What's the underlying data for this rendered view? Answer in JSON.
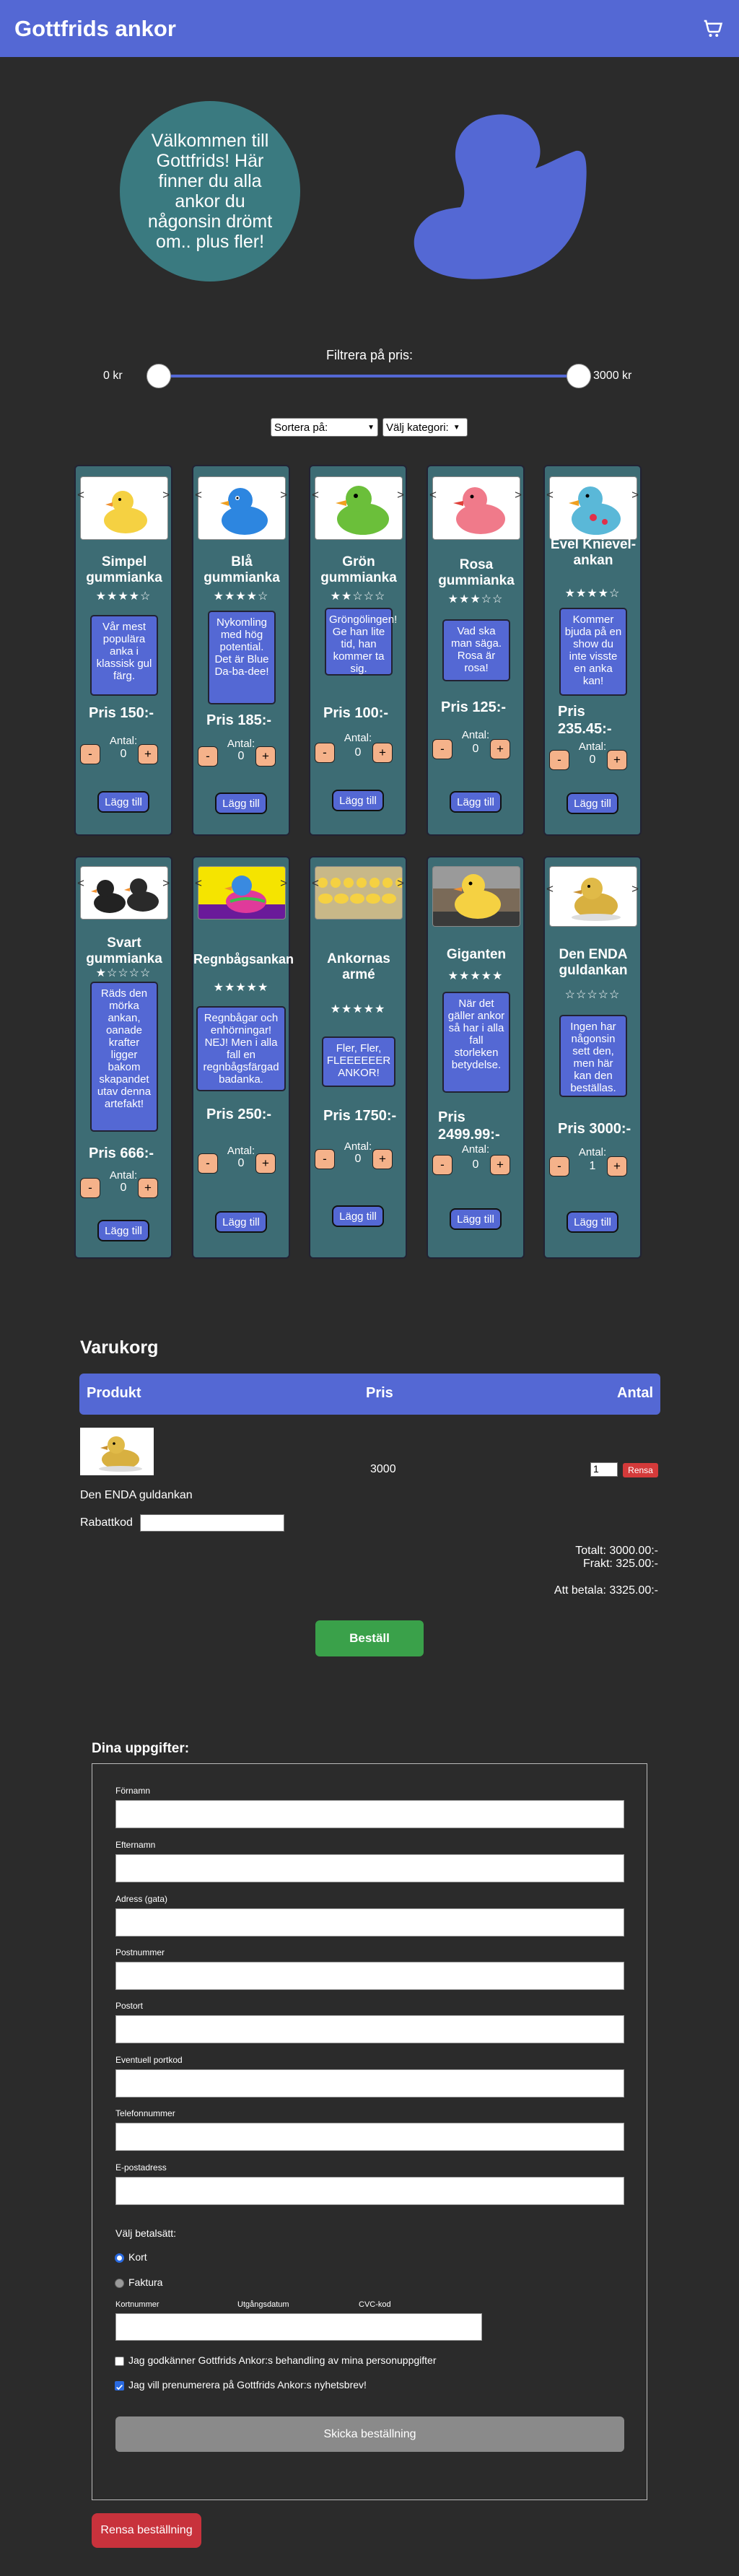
{
  "header": {
    "title": "Gottfrids ankor",
    "cart_icon": "cart-icon"
  },
  "hero": {
    "welcome": "Välkommen till Gottfrids! Här finner du alla ankor du någonsin drömt om.. plus fler!"
  },
  "filter": {
    "label": "Filtrera på pris:",
    "min_label": "0 kr",
    "max_label": "3000 kr",
    "min_value": 0,
    "max_value": 3000
  },
  "sort": {
    "sort_label": "Sortera på:",
    "category_label": "Välj kategori:"
  },
  "products": [
    {
      "name": "Simpel gummianka",
      "stars": "★★★★☆",
      "desc": "Vår mest populära anka i klassisk gul färg.",
      "price": "Pris 150:-",
      "qty_label": "Antal:",
      "qty": "0",
      "add": "Lägg till",
      "arrow_left": "<",
      "arrow_right": ">"
    },
    {
      "name": "Blå gummianka",
      "stars": "★★★★☆",
      "desc": "Nykomling med hög potential. Det är Blue Da-ba-dee!",
      "price": "Pris 185:-",
      "qty_label": "Antal:",
      "qty": "0",
      "add": "Lägg till",
      "arrow_left": "<",
      "arrow_right": ">"
    },
    {
      "name": "Grön gummianka",
      "stars": "★★☆☆☆",
      "desc": "Gröngölingen! Ge han lite tid, han kommer ta sig.",
      "price": "Pris 100:-",
      "qty_label": "Antal:",
      "qty": "0",
      "add": "Lägg till",
      "arrow_left": "<",
      "arrow_right": ">"
    },
    {
      "name": "Rosa gummianka",
      "stars": "★★★☆☆",
      "desc": "Vad ska man säga. Rosa är rosa!",
      "price": "Pris 125:-",
      "qty_label": "Antal:",
      "qty": "0",
      "add": "Lägg till",
      "arrow_left": "<",
      "arrow_right": ">"
    },
    {
      "name": "Evel Knievel-ankan",
      "stars": "★★★★☆",
      "desc": "Kommer bjuda på en show du inte visste en anka kan!",
      "price": "Pris 235.45:-",
      "qty_label": "Antal:",
      "qty": "0",
      "add": "Lägg till",
      "arrow_left": "<",
      "arrow_right": ">"
    },
    {
      "name": "Svart gummianka",
      "stars": "★☆☆☆☆",
      "desc": "Räds den mörka ankan, oanade krafter ligger bakom skapandet utav denna artefakt!",
      "price": "Pris 666:-",
      "qty_label": "Antal:",
      "qty": "0",
      "add": "Lägg till",
      "arrow_left": "<",
      "arrow_right": ">"
    },
    {
      "name": "Regnbågsankan",
      "stars": "★★★★★",
      "desc": "Regnbågar och enhörningar! NEJ! Men i alla fall en regnbågsfärgad badanka.",
      "price": "Pris 250:-",
      "qty_label": "Antal:",
      "qty": "0",
      "add": "Lägg till",
      "arrow_left": "<",
      "arrow_right": ">"
    },
    {
      "name": "Ankornas armé",
      "stars": "★★★★★",
      "desc": "Fler, Fler, FLEEEEEER ANKOR!",
      "price": "Pris 1750:-",
      "qty_label": "Antal:",
      "qty": "0",
      "add": "Lägg till",
      "arrow_left": "<",
      "arrow_right": ">"
    },
    {
      "name": "Giganten",
      "stars": "★★★★★",
      "desc": "När det gäller ankor så har i alla fall storleken betydelse.",
      "price": "Pris 2499.99:-",
      "qty_label": "Antal:",
      "qty": "0",
      "add": "Lägg till",
      "arrow_left": "<",
      "arrow_right": ">"
    },
    {
      "name": "Den ENDA guldankan",
      "stars": "☆☆☆☆☆",
      "desc": "Ingen har någonsin sett den, men här kan den beställas.",
      "price": "Pris 3000:-",
      "qty_label": "Antal:",
      "qty": "1",
      "add": "Lägg till",
      "arrow_left": "<",
      "arrow_right": ">"
    }
  ],
  "cart": {
    "title": "Varukorg",
    "col_product": "Produkt",
    "col_price": "Pris",
    "col_qty": "Antal",
    "item_name": "Den ENDA guldankan",
    "item_price": "3000",
    "item_qty": "1",
    "remove": "Rensa",
    "discount_label": "Rabattkod",
    "total": "Totalt: 3000.00:-",
    "shipping": "Frakt: 325.00:-",
    "to_pay": "Att betala: 3325.00:-",
    "order": "Beställ"
  },
  "form": {
    "title": "Dina uppgifter:",
    "fields": [
      "Förnamn",
      "Efternamn",
      "Adress (gata)",
      "Postnummer",
      "Postort",
      "Eventuell portkod",
      "Telefonnummer",
      "E-postadress"
    ],
    "payment_label": "Välj betalsätt:",
    "payment_card": "Kort",
    "payment_invoice": "Faktura",
    "card_number": "Kortnummer",
    "expiry": "Utgångsdatum",
    "cvc": "CVC-kod",
    "gdpr": "Jag godkänner Gottfrids Ankor:s behandling av mina personuppgifter",
    "newsletter": "Jag vill prenumerera på Gottfrids Ankor:s nyhetsbrev!",
    "submit": "Skicka beställning",
    "clear": "Rensa beställning"
  }
}
